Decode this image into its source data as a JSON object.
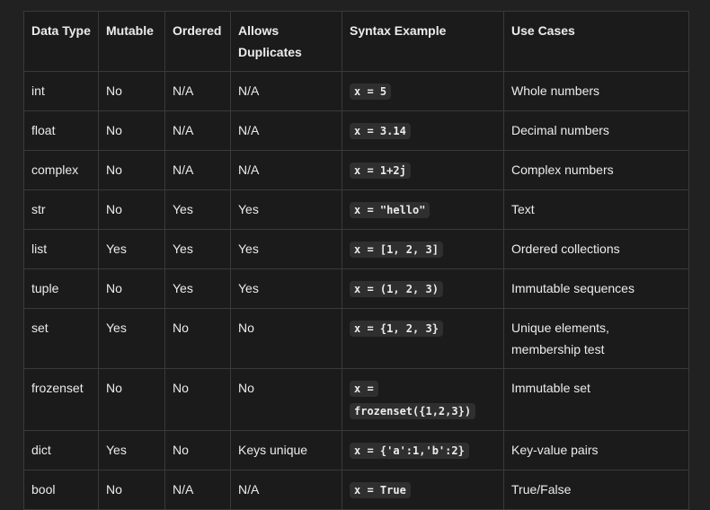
{
  "table": {
    "headers": {
      "data_type": "Data Type",
      "mutable": "Mutable",
      "ordered": "Ordered",
      "allows_duplicates": "Allows Duplicates",
      "syntax_example": "Syntax Example",
      "use_cases": "Use Cases"
    },
    "rows": [
      {
        "type": "int",
        "mutable": "No",
        "ordered": "N/A",
        "duplicates": "N/A",
        "syntax": "x = 5",
        "use": "Whole numbers"
      },
      {
        "type": "float",
        "mutable": "No",
        "ordered": "N/A",
        "duplicates": "N/A",
        "syntax": "x = 3.14",
        "use": "Decimal numbers"
      },
      {
        "type": "complex",
        "mutable": "No",
        "ordered": "N/A",
        "duplicates": "N/A",
        "syntax": "x = 1+2j",
        "use": "Complex numbers"
      },
      {
        "type": "str",
        "mutable": "No",
        "ordered": "Yes",
        "duplicates": "Yes",
        "syntax": "x = \"hello\"",
        "use": "Text"
      },
      {
        "type": "list",
        "mutable": "Yes",
        "ordered": "Yes",
        "duplicates": "Yes",
        "syntax": "x = [1, 2, 3]",
        "use": "Ordered collections"
      },
      {
        "type": "tuple",
        "mutable": "No",
        "ordered": "Yes",
        "duplicates": "Yes",
        "syntax": "x = (1, 2, 3)",
        "use": "Immutable sequences"
      },
      {
        "type": "set",
        "mutable": "Yes",
        "ordered": "No",
        "duplicates": "No",
        "syntax": "x = {1, 2, 3}",
        "use": "Unique elements, membership test"
      },
      {
        "type": "frozenset",
        "mutable": "No",
        "ordered": "No",
        "duplicates": "No",
        "syntax": "x = frozenset({1,2,3})",
        "use": "Immutable set"
      },
      {
        "type": "dict",
        "mutable": "Yes",
        "ordered": "No",
        "duplicates": "Keys unique",
        "syntax": "x = {'a':1,'b':2}",
        "use": "Key-value pairs"
      },
      {
        "type": "bool",
        "mutable": "No",
        "ordered": "N/A",
        "duplicates": "N/A",
        "syntax": "x = True",
        "use": "True/False"
      }
    ]
  }
}
